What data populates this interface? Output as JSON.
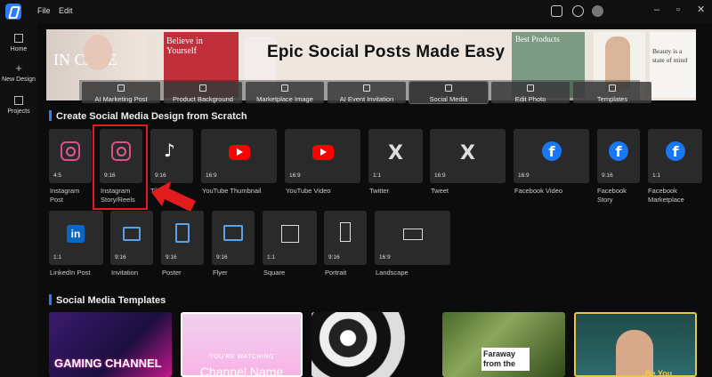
{
  "menu": {
    "file": "File",
    "edit": "Edit"
  },
  "sidebar": {
    "items": [
      {
        "label": "Home",
        "icon": "home-icon"
      },
      {
        "label": "New Design",
        "icon": "plus-icon"
      },
      {
        "label": "Projects",
        "icon": "folder-icon"
      }
    ]
  },
  "banner": {
    "title": "Epic Social Posts Made Easy",
    "left_text": "IN CARE",
    "card1_text": "Believe in Yourself",
    "card2_text": "Best Products",
    "card3_text": "Beauty is a state of mind"
  },
  "categories": [
    {
      "label": "AI Marketing Post",
      "active": false
    },
    {
      "label": "Product Background",
      "active": false
    },
    {
      "label": "Marketplace Image",
      "active": false
    },
    {
      "label": "AI Event Invitation",
      "active": false
    },
    {
      "label": "Social Media",
      "active": true
    },
    {
      "label": "Edit Photo",
      "active": false
    },
    {
      "label": "Templates",
      "active": false
    }
  ],
  "sections": {
    "scratch": "Create Social Media Design from Scratch",
    "templates": "Social Media Templates"
  },
  "row1": [
    {
      "label": "Instagram Post",
      "ratio": "4:5",
      "icon": "instagram-icon"
    },
    {
      "label": "Instagram Story/Reels",
      "ratio": "9:16",
      "icon": "instagram-icon"
    },
    {
      "label": "TikTok",
      "ratio": "9:16",
      "icon": "tiktok-icon"
    },
    {
      "label": "YouTube Thumbnail",
      "ratio": "16:9",
      "icon": "youtube-icon"
    },
    {
      "label": "YouTube Video",
      "ratio": "16:9",
      "icon": "youtube-icon"
    },
    {
      "label": "Twitter",
      "ratio": "1:1",
      "icon": "x-icon"
    },
    {
      "label": "Tweet",
      "ratio": "16:9",
      "icon": "x-icon"
    },
    {
      "label": "Facebook Video",
      "ratio": "16:9",
      "icon": "facebook-icon"
    },
    {
      "label": "Facebook Story",
      "ratio": "9:16",
      "icon": "facebook-icon"
    },
    {
      "label": "Facebook Marketplace",
      "ratio": "1:1",
      "icon": "facebook-icon"
    }
  ],
  "row2": [
    {
      "label": "LinkedIn Post",
      "ratio": "1:1",
      "icon": "linkedin-icon"
    },
    {
      "label": "Invitation",
      "ratio": "9:16",
      "icon": "envelope-icon"
    },
    {
      "label": "Poster",
      "ratio": "9:16",
      "icon": "poster-icon"
    },
    {
      "label": "Flyer",
      "ratio": "9:16",
      "icon": "flyer-icon"
    },
    {
      "label": "Square",
      "ratio": "1:1",
      "icon": "square-icon"
    },
    {
      "label": "Portrait",
      "ratio": "9:16",
      "icon": "portrait-icon"
    },
    {
      "label": "Landscape",
      "ratio": "16:9",
      "icon": "landscape-icon"
    }
  ],
  "templates": [
    {
      "text": "GAMING CHANNEL"
    },
    {
      "text": "YOU'RE WATCHING",
      "text2": "Channel Name"
    },
    {
      "text": ""
    },
    {
      "text": "Faraway from the"
    },
    {
      "text": "Be You"
    }
  ],
  "colors": {
    "accent": "#2e7cf6",
    "highlight": "#e21c1c"
  }
}
